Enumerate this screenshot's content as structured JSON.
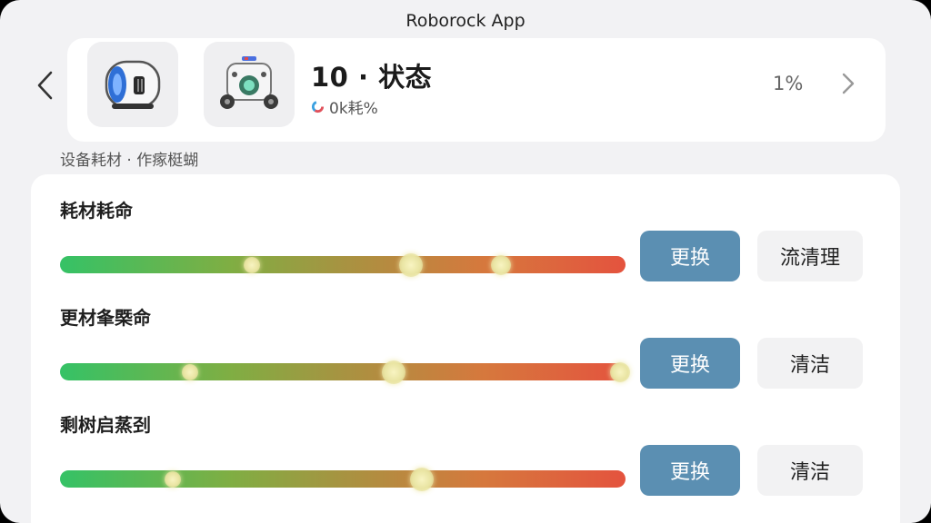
{
  "app": {
    "title": "Roborock App"
  },
  "header": {
    "device_title": "10 · 状态",
    "device_subtitle": "0k耗%",
    "percent": "1%"
  },
  "section": {
    "label": "设备耗材 · 作瘃梃蝴"
  },
  "consumables": [
    {
      "label": "耗材耗命",
      "progress_markers": [
        0.34,
        0.62,
        0.78
      ],
      "primary_button": "更换",
      "secondary_button": "流清理"
    },
    {
      "label": "更材夆槩命",
      "progress_markers": [
        0.23,
        0.59,
        0.99
      ],
      "primary_button": "更换",
      "secondary_button": "清洁"
    },
    {
      "label": "剩树启蒸刭",
      "progress_markers": [
        0.2,
        0.64
      ],
      "primary_button": "更换",
      "secondary_button": "清洁"
    }
  ],
  "colors": {
    "primary_button": "#5b8fb2",
    "bar_start": "#35c266",
    "bar_end": "#e4533e",
    "background": "#f2f2f4"
  },
  "icons": {
    "back": "chevron-left-icon",
    "forward": "chevron-right-icon",
    "status": "ring-status-icon"
  }
}
